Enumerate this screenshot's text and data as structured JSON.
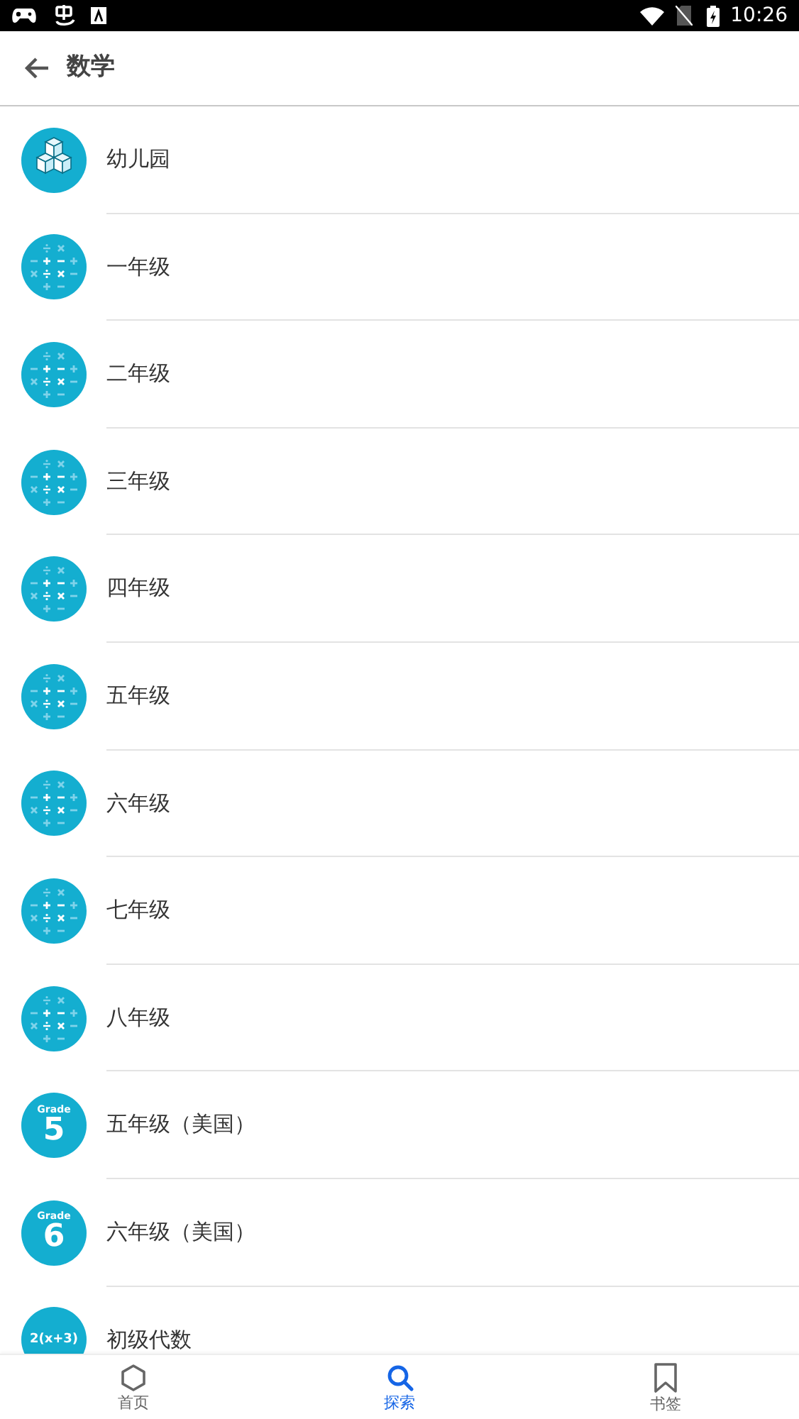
{
  "status_bar": {
    "time": "10:26"
  },
  "header": {
    "title": "数学"
  },
  "items": [
    {
      "label": "幼儿园",
      "icon": {
        "kind": "blocks"
      }
    },
    {
      "label": "一年级",
      "icon": {
        "kind": "operators"
      }
    },
    {
      "label": "二年级",
      "icon": {
        "kind": "operators"
      }
    },
    {
      "label": "三年级",
      "icon": {
        "kind": "operators"
      }
    },
    {
      "label": "四年级",
      "icon": {
        "kind": "operators"
      }
    },
    {
      "label": "五年级",
      "icon": {
        "kind": "operators"
      }
    },
    {
      "label": "六年级",
      "icon": {
        "kind": "operators"
      }
    },
    {
      "label": "七年级",
      "icon": {
        "kind": "operators"
      }
    },
    {
      "label": "八年级",
      "icon": {
        "kind": "operators"
      }
    },
    {
      "label": "五年级（美国）",
      "icon": {
        "kind": "grade",
        "caption": "Grade",
        "number": "5"
      }
    },
    {
      "label": "六年级（美国）",
      "icon": {
        "kind": "grade",
        "caption": "Grade",
        "number": "6"
      }
    },
    {
      "label": "初级代数",
      "icon": {
        "kind": "formula",
        "text": "2(x+3)"
      }
    }
  ],
  "bottom_nav": [
    {
      "label": "首页",
      "kind": "hexagon",
      "selected": false
    },
    {
      "label": "探索",
      "kind": "search",
      "selected": true
    },
    {
      "label": "书签",
      "kind": "bookmark",
      "selected": false
    }
  ]
}
